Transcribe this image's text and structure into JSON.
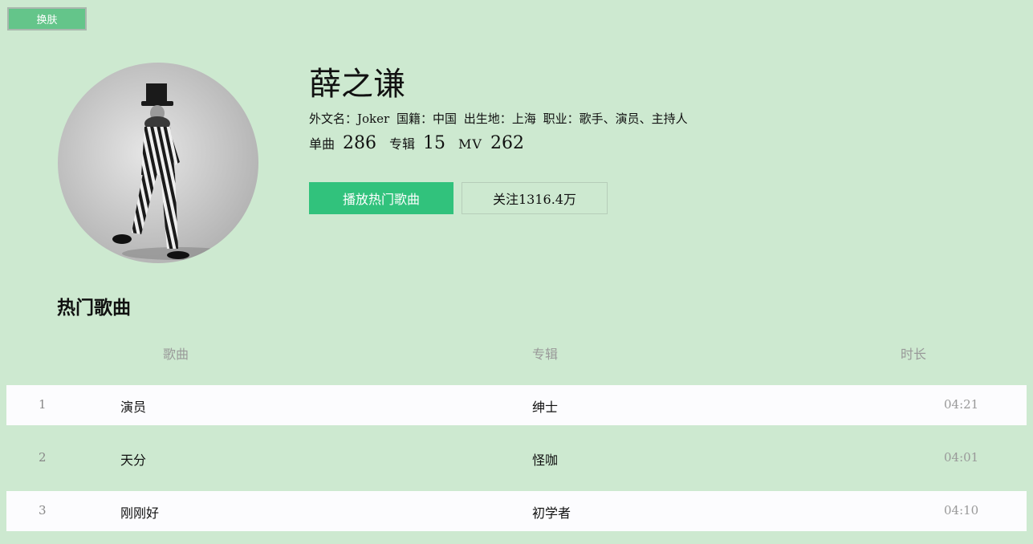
{
  "toolbar": {
    "skin_label": "换肤"
  },
  "artist": {
    "name": "薛之谦",
    "meta": [
      {
        "label": "外文名：",
        "value": "Joker"
      },
      {
        "label": "国籍：",
        "value": "中国"
      },
      {
        "label": "出生地：",
        "value": "上海"
      },
      {
        "label": "职业：",
        "value": "歌手、演员、主持人"
      }
    ],
    "stats": {
      "songs_label": "单曲",
      "songs_value": "286",
      "albums_label": "专辑",
      "albums_value": "15",
      "mv_label": "MV",
      "mv_value": "262"
    }
  },
  "actions": {
    "play_label": "播放热门歌曲",
    "follow_label": "关注1316.4万"
  },
  "hot_songs": {
    "title": "热门歌曲",
    "columns": {
      "song": "歌曲",
      "album": "专辑",
      "duration": "时长"
    },
    "rows": [
      {
        "num": "1",
        "title": "演员",
        "album": "绅士",
        "duration": "04:21"
      },
      {
        "num": "2",
        "title": "天分",
        "album": "怪咖",
        "duration": "04:01"
      },
      {
        "num": "3",
        "title": "刚刚好",
        "album": "初学者",
        "duration": "04:10"
      }
    ]
  },
  "colors": {
    "page_bg": "#cde9d0",
    "accent_green": "#31c27c",
    "skin_button": "#64c58a",
    "row_light": "#fcfcfe"
  }
}
